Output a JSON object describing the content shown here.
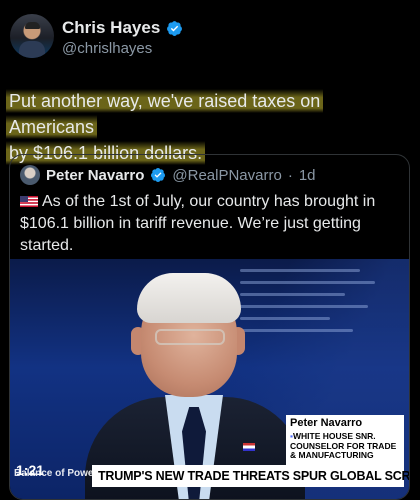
{
  "author": {
    "name": "Chris Hayes",
    "handle": "@chrislhayes",
    "verified": true,
    "avatar_icon": "profile-photo-icon"
  },
  "tweet": {
    "text_line1": "Put another way, we've raised taxes on Americans",
    "text_line2": "by $106.1 billion dollars.",
    "highlight_color": "#fff03c"
  },
  "quoted_tweet": {
    "name": "Peter Navarro",
    "handle": "@RealPNavarro",
    "separator": "·",
    "time": "1d",
    "flag_icon": "us-flag-icon",
    "text": "As of the 1st of July, our country has brought in $106.1 billion in tariff revenue. We’re just getting started."
  },
  "media": {
    "timestamp": "1:21",
    "watermark": "Balance of Power",
    "lower_third_name": "Peter Navarro",
    "lower_third_title": "WHITE HOUSE SNR. COUNSELOR FOR TRADE & MANUFACTURING",
    "headline": "TRUMP'S NEW TRADE THREATS SPUR GLOBAL SCRAMBLE"
  },
  "colors": {
    "background": "#000000",
    "text": "#e7e9ea",
    "secondary_text": "#8b98a5",
    "verified_blue": "#1d9bf0",
    "border": "#2f3336"
  }
}
